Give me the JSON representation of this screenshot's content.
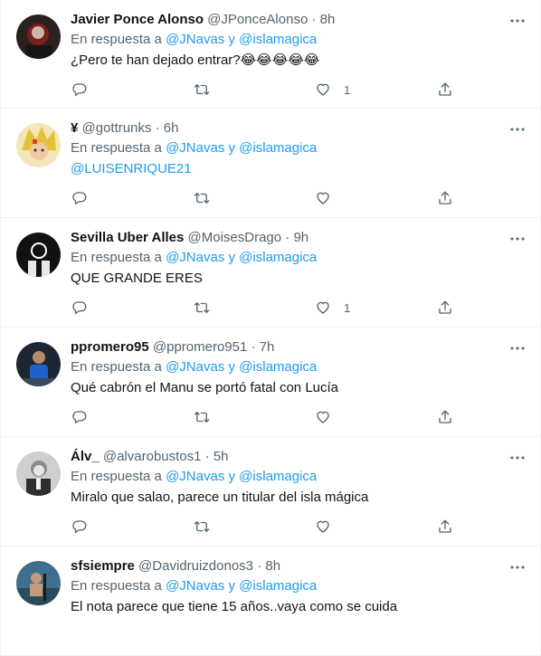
{
  "reply_prefix": "En respuesta a",
  "reply_and": "y",
  "icons": {
    "reply": "reply-icon",
    "retweet": "retweet-icon",
    "like": "heart-icon",
    "share": "share-icon",
    "more": "more-icon"
  },
  "colors": {
    "link": "#1d9bf0",
    "secondary": "#536471",
    "primary_text": "#0f1419",
    "divider": "#eff3f4"
  },
  "tweets": [
    {
      "name": "Javier Ponce Alonso",
      "handle": "@JPonceAlonso",
      "dot": "·",
      "time": "8h",
      "mentions": [
        "@JNavas",
        "@islamagica"
      ],
      "text": "¿Pero te han dejado entrar?",
      "emoji": [
        "😂",
        "😂",
        "😂",
        "😂",
        "😂"
      ],
      "likes": "1"
    },
    {
      "name": "¥",
      "handle": "@gottrunks",
      "dot": "·",
      "time": "6h",
      "mentions": [
        "@JNavas",
        "@islamagica"
      ],
      "text": "@LUISENRIQUE21",
      "likes": ""
    },
    {
      "name": "Sevilla Uber Alles",
      "handle": "@MoisesDrago",
      "dot": "·",
      "time": "9h",
      "mentions": [
        "@JNavas",
        "@islamagica"
      ],
      "text": "QUE GRANDE ERES",
      "likes": "1"
    },
    {
      "name": "ppromero95",
      "handle": "@ppromero951",
      "dot": "·",
      "time": "7h",
      "mentions": [
        "@JNavas",
        "@islamagica"
      ],
      "text": "Qué cabrón el Manu se portó fatal con Lucía",
      "likes": ""
    },
    {
      "name": "Álv_",
      "handle": "@alvarobustos1",
      "dot": "·",
      "time": "5h",
      "mentions": [
        "@JNavas",
        "@islamagica"
      ],
      "text": "Miralo que salao, parece un titular del isla mágica",
      "likes": ""
    },
    {
      "name": "sfsiempre",
      "handle": "@Davidruizdonos3",
      "dot": "·",
      "time": "8h",
      "mentions": [
        "@JNavas",
        "@islamagica"
      ],
      "text": "El nota parece que tiene 15 años..vaya como se cuida",
      "likes": ""
    }
  ]
}
